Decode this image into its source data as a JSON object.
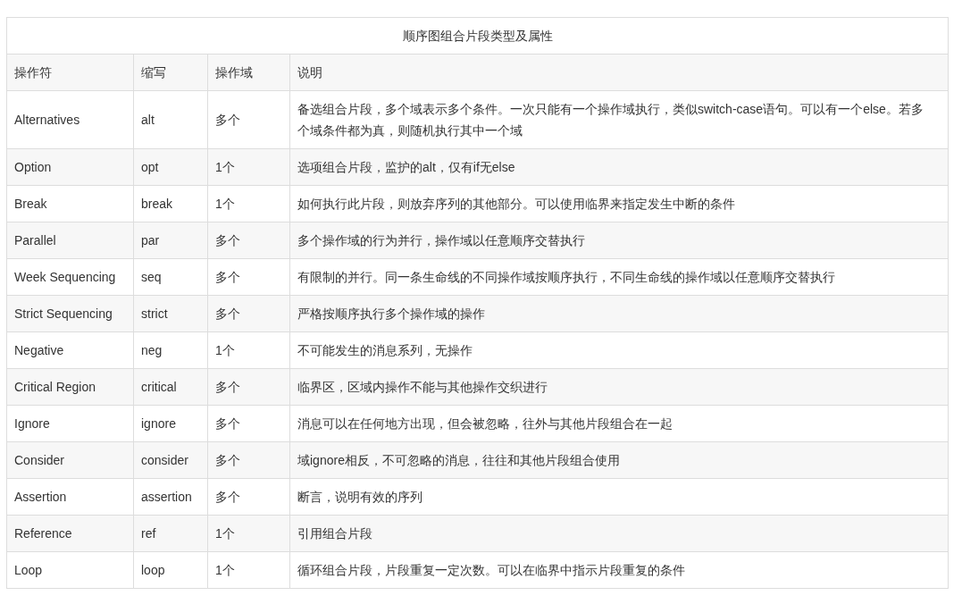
{
  "table": {
    "caption": "顺序图组合片段类型及属性",
    "columns": [
      "操作符",
      "缩写",
      "操作域",
      "说明"
    ],
    "rows": [
      [
        "Alternatives",
        "alt",
        "多个",
        "备选组合片段，多个域表示多个条件。一次只能有一个操作域执行，类似switch-case语句。可以有一个else。若多个域条件都为真，则随机执行其中一个域"
      ],
      [
        "Option",
        "opt",
        "1个",
        "选项组合片段，监护的alt，仅有if无else"
      ],
      [
        "Break",
        "break",
        "1个",
        "如何执行此片段，则放弃序列的其他部分。可以使用临界来指定发生中断的条件"
      ],
      [
        "Parallel",
        "par",
        "多个",
        "多个操作域的行为并行，操作域以任意顺序交替执行"
      ],
      [
        "Week Sequencing",
        "seq",
        "多个",
        "有限制的并行。同一条生命线的不同操作域按顺序执行，不同生命线的操作域以任意顺序交替执行"
      ],
      [
        "Strict Sequencing",
        "strict",
        "多个",
        "严格按顺序执行多个操作域的操作"
      ],
      [
        "Negative",
        "neg",
        "1个",
        "不可能发生的消息系列，无操作"
      ],
      [
        "Critical Region",
        "critical",
        "多个",
        "临界区，区域内操作不能与其他操作交织进行"
      ],
      [
        "Ignore",
        "ignore",
        "多个",
        "消息可以在任何地方出现，但会被忽略，往外与其他片段组合在一起"
      ],
      [
        "Consider",
        "consider",
        "多个",
        "域ignore相反，不可忽略的消息，往往和其他片段组合使用"
      ],
      [
        "Assertion",
        "assertion",
        "多个",
        "断言，说明有效的序列"
      ],
      [
        "Reference",
        "ref",
        "1个",
        "引用组合片段"
      ],
      [
        "Loop",
        "loop",
        "1个",
        "循环组合片段，片段重复一定次数。可以在临界中指示片段重复的条件"
      ]
    ]
  }
}
